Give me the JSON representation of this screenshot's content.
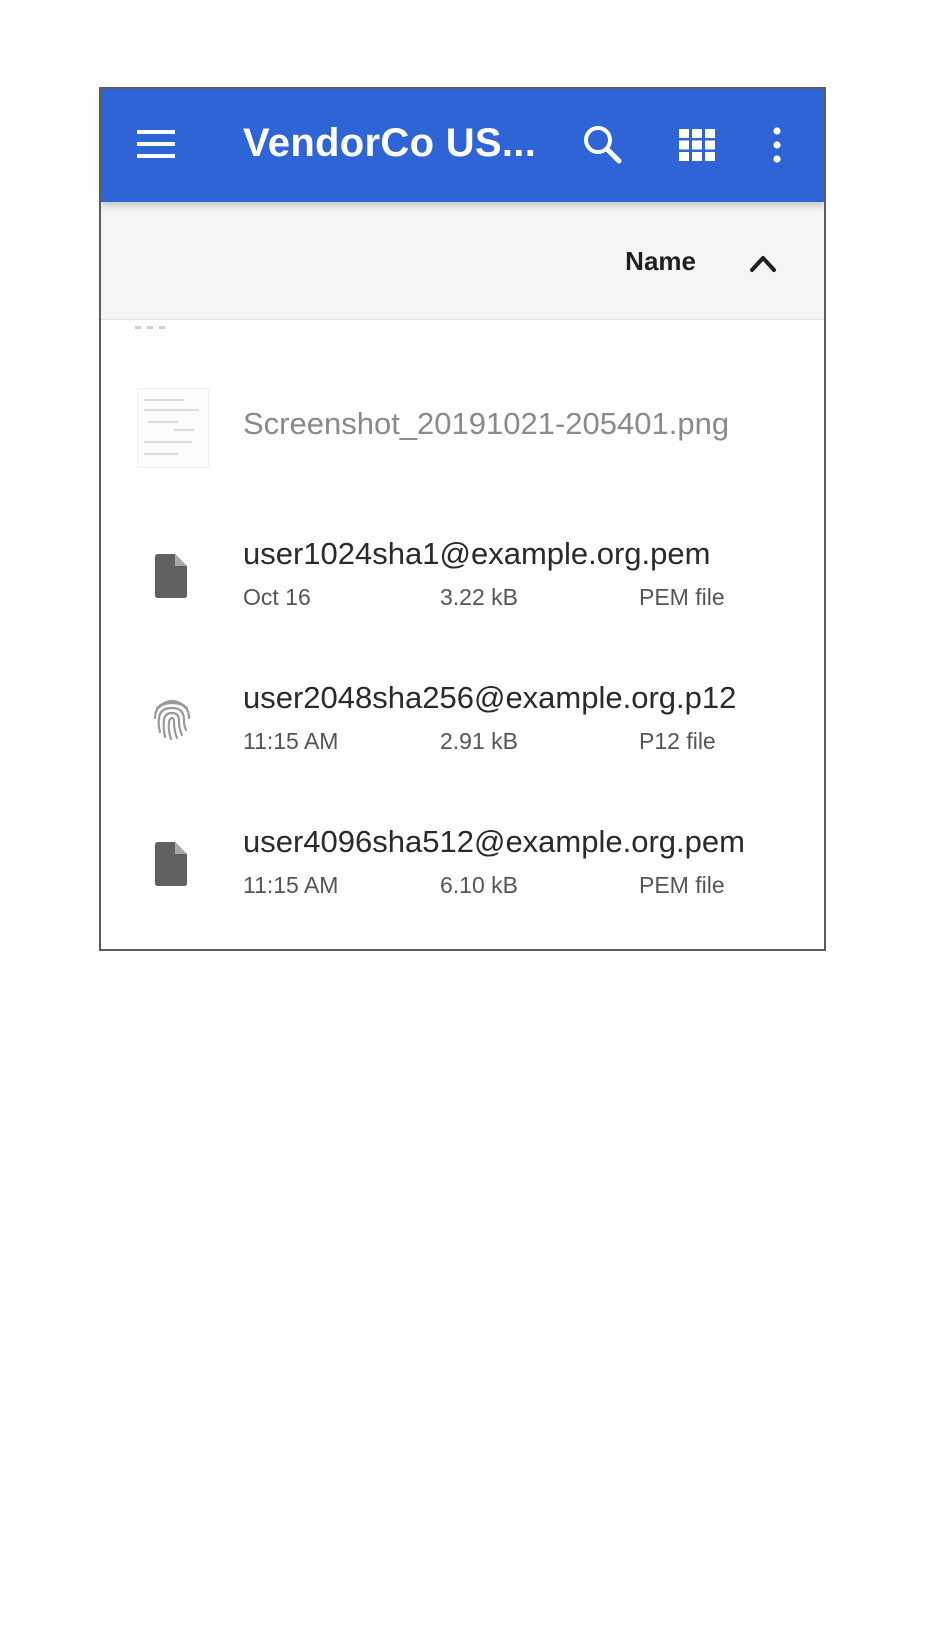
{
  "app_bar": {
    "title": "VendorCo US...",
    "background_color": "#2f64d6",
    "menu_icon": "hamburger-menu-icon",
    "search_icon": "search-icon",
    "grid_icon": "grid-view-icon",
    "more_icon": "more-vert-icon"
  },
  "sort": {
    "label": "Name",
    "direction_icon": "chevron-up-icon"
  },
  "files": [
    {
      "name": "Screenshot_20191021-205401.png",
      "icon": "image-thumbnail",
      "dimmed": true
    },
    {
      "name": "user1024sha1@example.org.pem",
      "date": "Oct 16",
      "size": "3.22 kB",
      "type": "PEM file",
      "icon": "document-icon"
    },
    {
      "name": "user2048sha256@example.org.p12",
      "date": "11:15 AM",
      "size": "2.91 kB",
      "type": "P12 file",
      "icon": "fingerprint-icon"
    },
    {
      "name": "user4096sha512@example.org.pem",
      "date": "11:15 AM",
      "size": "6.10 kB",
      "type": "PEM file",
      "icon": "document-icon"
    }
  ]
}
